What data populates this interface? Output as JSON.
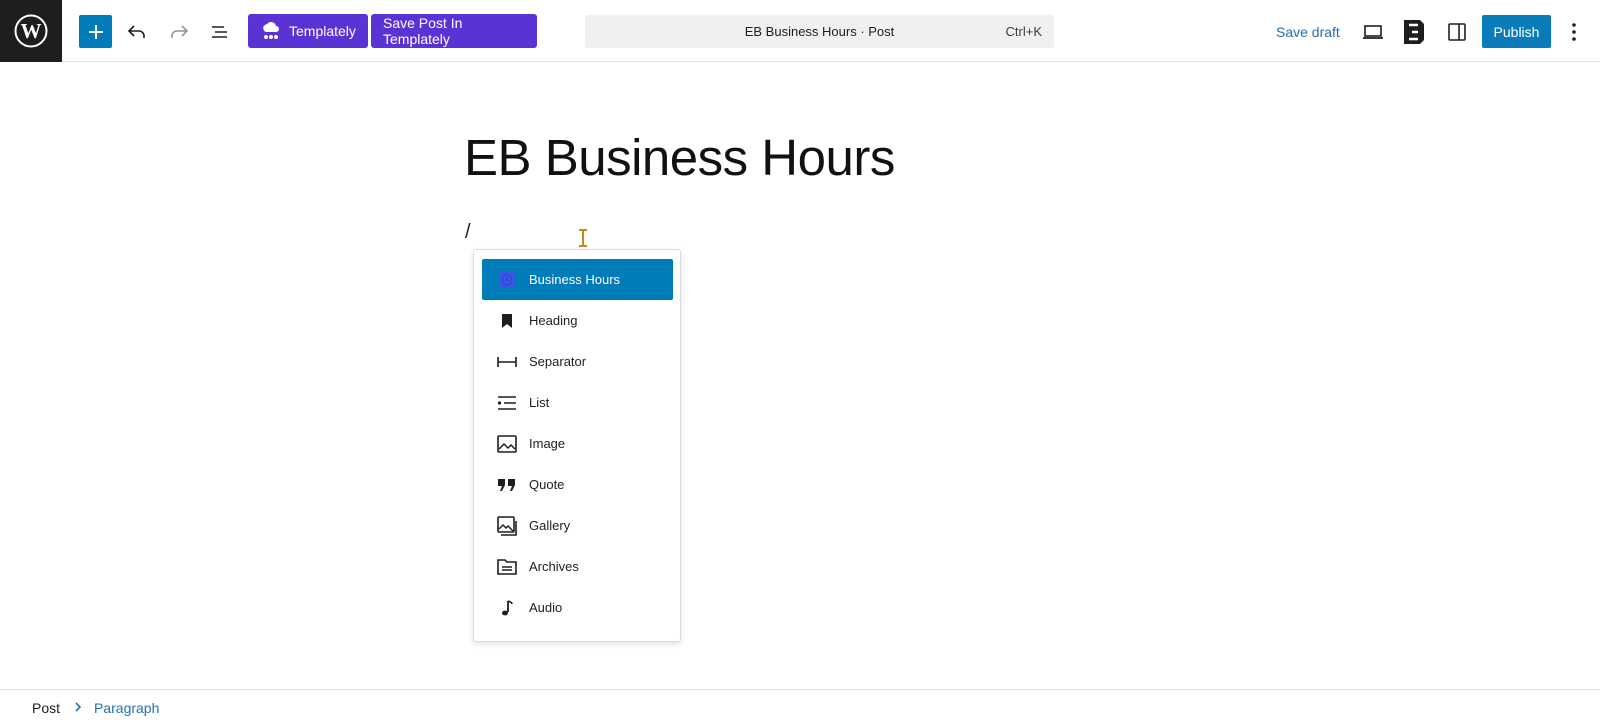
{
  "toolbar": {
    "templately_label": "Templately",
    "save_templately_label": "Save Post In Templately",
    "command_bar_title": "EB Business Hours · Post",
    "command_bar_shortcut": "Ctrl+K",
    "save_draft_label": "Save draft",
    "publish_label": "Publish"
  },
  "post": {
    "title": "EB Business Hours",
    "paragraph_text": "/"
  },
  "inserter": {
    "items": [
      {
        "label": "Business Hours",
        "icon": "business-hours-icon",
        "selected": true
      },
      {
        "label": "Heading",
        "icon": "bookmark-icon"
      },
      {
        "label": "Separator",
        "icon": "separator-icon"
      },
      {
        "label": "List",
        "icon": "list-icon"
      },
      {
        "label": "Image",
        "icon": "image-icon"
      },
      {
        "label": "Quote",
        "icon": "quote-icon"
      },
      {
        "label": "Gallery",
        "icon": "gallery-icon"
      },
      {
        "label": "Archives",
        "icon": "archives-icon"
      },
      {
        "label": "Audio",
        "icon": "audio-icon"
      }
    ]
  },
  "breadcrumb": {
    "root": "Post",
    "current": "Paragraph"
  },
  "colors": {
    "accent": "#007cba",
    "templately": "#5b33d4",
    "link": "#2271b1"
  }
}
